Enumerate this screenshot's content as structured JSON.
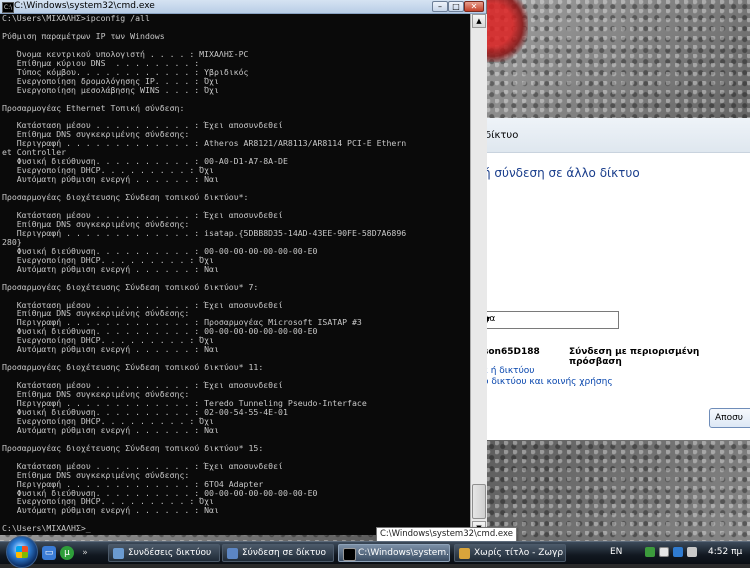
{
  "cmd": {
    "title": "C:\\Windows\\system32\\cmd.exe",
    "icon_text": "C:\\",
    "controls": {
      "minimize": "–",
      "maximize": "□",
      "close": "✕"
    },
    "lines": [
      "C:\\Users\\ΜΙΧΑΛΗΣ>ipconfig /all",
      "",
      "Ρύθμιση παραμέτρων IP των Windows",
      "",
      "   Όνομα κεντρικού υπολογιστή . . . . : ΜΙΧΑΛΗΣ-PC",
      "   Επίθημα κύριου DNS  . . . . . . . . :",
      "   Τύπος κόμβου. . . . . . . . . . . . : Υβριδικός",
      "   Ενεργοποίηση δρομολόγησης IP. . . . : Όχι",
      "   Ενεργοποίηση μεσολάβησης WINS . . . : Όχι",
      "",
      "Προσαρμογέας Ethernet Τοπική σύνδεση:",
      "",
      "   Κατάσταση μέσου . . . . . . . . . . : Έχει αποσυνδεθεί",
      "   Επίθημα DNS συγκεκριμένης σύνδεσης:",
      "   Περιγραφή . . . . . . . . . . . . . : Atheros AR8121/AR8113/AR8114 PCI-E Ethern",
      "et Controller",
      "   Φυσική διεύθυνση. . . . . . . . . . : 00-A0-D1-A7-8A-DE",
      "   Ενεργοποίηση DHCP. . . . . . . . . : Όχι",
      "   Αυτόματη ρύθμιση ενεργή . . . . . . : Ναι",
      "",
      "Προσαρμογέας διοχέτευσης Σύνδεση τοπικού δικτύου*:",
      "",
      "   Κατάσταση μέσου . . . . . . . . . . : Έχει αποσυνδεθεί",
      "   Επίθημα DNS συγκεκριμένης σύνδεσης:",
      "   Περιγραφή . . . . . . . . . . . . . : isatap.{5DBB8D35-14AD-43EE-90FE-58D7A6896",
      "280}",
      "   Φυσική διεύθυνση. . . . . . . . . . : 00-00-00-00-00-00-00-E0",
      "   Ενεργοποίηση DHCP. . . . . . . . . : Όχι",
      "   Αυτόματη ρύθμιση ενεργή . . . . . . : Ναι",
      "",
      "Προσαρμογέας διοχέτευσης Σύνδεση τοπικού δικτύου* 7:",
      "",
      "   Κατάσταση μέσου . . . . . . . . . . : Έχει αποσυνδεθεί",
      "   Επίθημα DNS συγκεκριμένης σύνδεσης:",
      "   Περιγραφή . . . . . . . . . . . . . : Προσαρμογέας Microsoft ISATAP #3",
      "   Φυσική διεύθυνση. . . . . . . . . . : 00-00-00-00-00-00-00-E0",
      "   Ενεργοποίηση DHCP. . . . . . . . . : Όχι",
      "   Αυτόματη ρύθμιση ενεργή . . . . . . : Ναι",
      "",
      "Προσαρμογέας διοχέτευσης Σύνδεση τοπικού δικτύου* 11:",
      "",
      "   Κατάσταση μέσου . . . . . . . . . . : Έχει αποσυνδεθεί",
      "   Επίθημα DNS συγκεκριμένης σύνδεσης:",
      "   Περιγραφή . . . . . . . . . . . . . : Teredo Tunneling Pseudo-Interface",
      "   Φυσική διεύθυνση. . . . . . . . . . : 02-00-54-55-4E-01",
      "   Ενεργοποίηση DHCP. . . . . . . . . : Όχι",
      "   Αυτόματη ρύθμιση ενεργή . . . . . . : Ναι",
      "",
      "Προσαρμογέας διοχέτευσης Σύνδεση τοπικού δικτύου* 15:",
      "",
      "   Κατάσταση μέσου . . . . . . . . . . : Έχει αποσυνδεθεί",
      "   Επίθημα DNS συγκεκριμένης σύνδεσης:",
      "   Περιγραφή . . . . . . . . . . . . . : 6TO4 Adapter",
      "   Φυσική διεύθυνση. . . . . . . . . . : 00-00-00-00-00-00-00-E0",
      "   Ενεργοποίηση DHCP. . . . . . . . . : Όχι",
      "   Αυτόματη ρύθμιση ενεργή . . . . . . : Ναι",
      "",
      "C:\\Users\\ΜΙΧΑΛΗΣ>_"
    ]
  },
  "network_window": {
    "header": "δίκτυο",
    "title": "ή σύνδεση σε άλλο δίκτυο",
    "dropdown_value": "λα",
    "network_name": "son65D188",
    "network_status": "Σύνδεση με περιορισμένη πρόσβαση",
    "links": [
      "ε ή δικτύου",
      "ο δικτύου και κοινής χρήσης"
    ],
    "button": "Αποσυ"
  },
  "tooltip": "C:\\Windows\\system32\\cmd.exe",
  "taskbar": {
    "tasks": [
      {
        "label": "Συνδέσεις δικτύου",
        "icon_color": "#6b9bd1"
      },
      {
        "label": "Σύνδεση σε δίκτυο",
        "icon_color": "#5c86c4"
      },
      {
        "label": "C:\\Windows\\system...",
        "icon_color": "#000000"
      },
      {
        "label": "Χωρίς τίτλο - Ζωγρ...",
        "icon_color": "#d9a43b"
      }
    ],
    "language": "EN",
    "clock": "4:52 πμ"
  }
}
